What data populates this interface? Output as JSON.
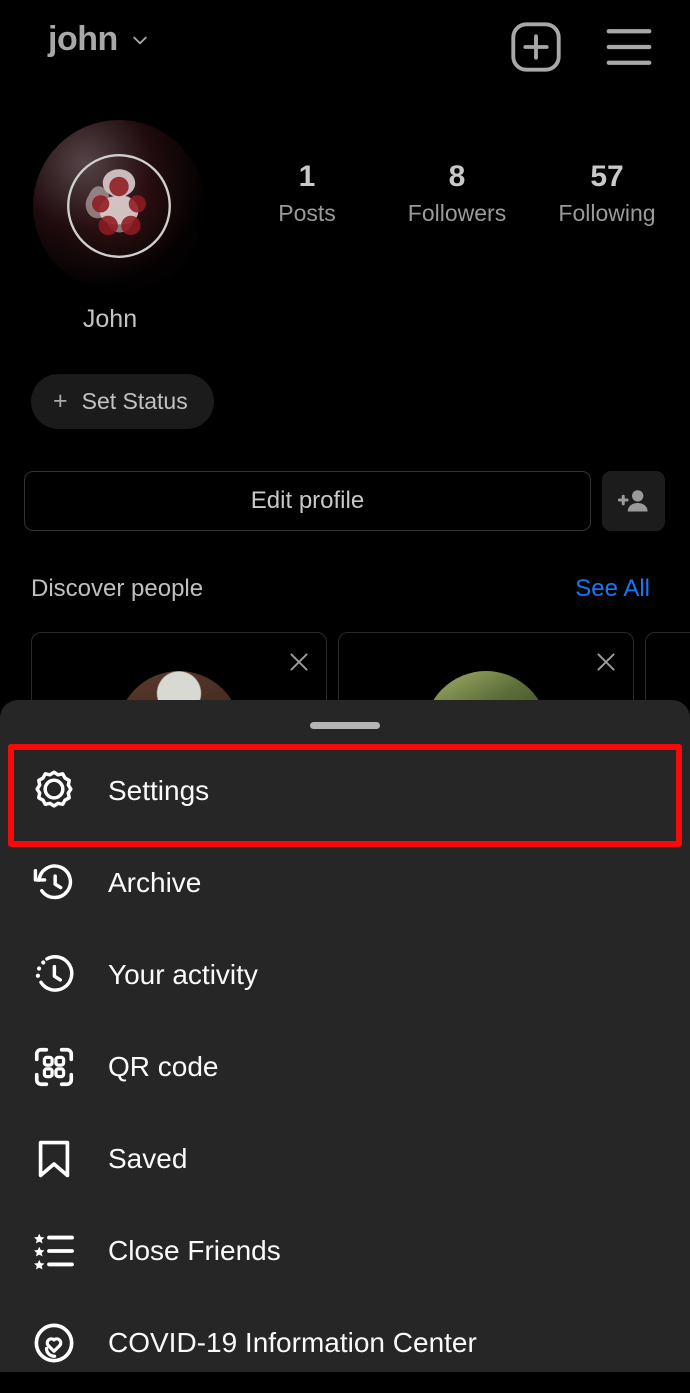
{
  "header": {
    "username": "john",
    "chevron_icon": "chevron-down-icon",
    "add_icon": "plus-square-icon",
    "menu_icon": "hamburger-menu-icon"
  },
  "profile": {
    "avatar_icon": "profile-avatar",
    "full_name": "John",
    "stats": [
      {
        "value": "1",
        "label": "Posts"
      },
      {
        "value": "8",
        "label": "Followers"
      },
      {
        "value": "57",
        "label": "Following"
      }
    ],
    "set_status_plus": "+",
    "set_status_label": "Set Status",
    "edit_profile_label": "Edit profile",
    "add_person_icon": "add-person-icon"
  },
  "discover": {
    "title": "Discover people",
    "see_all_label": "See All",
    "cards": [
      {
        "close_icon": "close-icon"
      },
      {
        "close_icon": "close-icon"
      },
      {
        "close_icon": "close-icon"
      }
    ]
  },
  "sheet": {
    "handle": "drag-handle",
    "highlight_color": "#f60b0b",
    "items": [
      {
        "label": "Settings",
        "icon": "gear-icon",
        "highlighted": true
      },
      {
        "label": "Archive",
        "icon": "archive-clock-icon",
        "highlighted": false
      },
      {
        "label": "Your activity",
        "icon": "activity-clock-icon",
        "highlighted": false
      },
      {
        "label": "QR code",
        "icon": "qr-code-icon",
        "highlighted": false
      },
      {
        "label": "Saved",
        "icon": "bookmark-icon",
        "highlighted": false
      },
      {
        "label": "Close Friends",
        "icon": "star-list-icon",
        "highlighted": false
      },
      {
        "label": "COVID-19 Information Center",
        "icon": "heart-circle-icon",
        "highlighted": false
      }
    ]
  },
  "colors": {
    "background": "#000000",
    "sheet_background": "#262626",
    "accent_link": "#1977f2",
    "highlight": "#f60b0b",
    "text_primary": "#fafafa",
    "text_secondary": "#a8a8a8"
  }
}
